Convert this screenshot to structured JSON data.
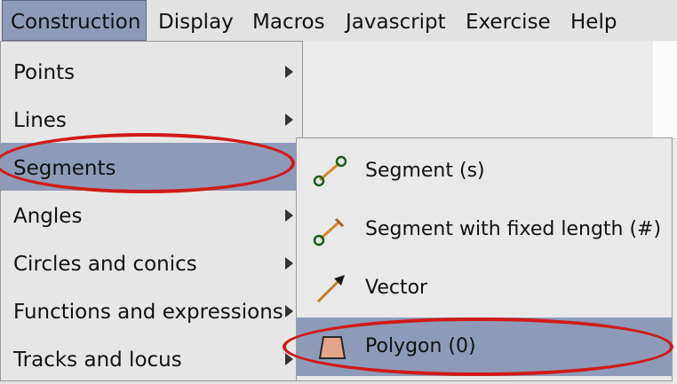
{
  "menubar": {
    "items": [
      "Construction",
      "Display",
      "Macros",
      "Javascript",
      "Exercise",
      "Help"
    ]
  },
  "construction_menu": {
    "items": [
      {
        "label": "Points"
      },
      {
        "label": "Lines"
      },
      {
        "label": "Segments"
      },
      {
        "label": "Angles"
      },
      {
        "label": "Circles and conics"
      },
      {
        "label": "Functions and expressions"
      },
      {
        "label": "Tracks and locus"
      }
    ]
  },
  "segments_submenu": {
    "items": [
      {
        "label": "Segment (s)",
        "icon": "segment-icon"
      },
      {
        "label": "Segment with fixed length (#)",
        "icon": "segment-fixed-length-icon"
      },
      {
        "label": "Vector",
        "icon": "vector-icon"
      },
      {
        "label": "Polygon (0)",
        "icon": "polygon-icon"
      }
    ]
  },
  "colors": {
    "selection": "#8e9bb8",
    "highlight": "#d11a1a",
    "menu_bg": "#e6e6e6"
  }
}
